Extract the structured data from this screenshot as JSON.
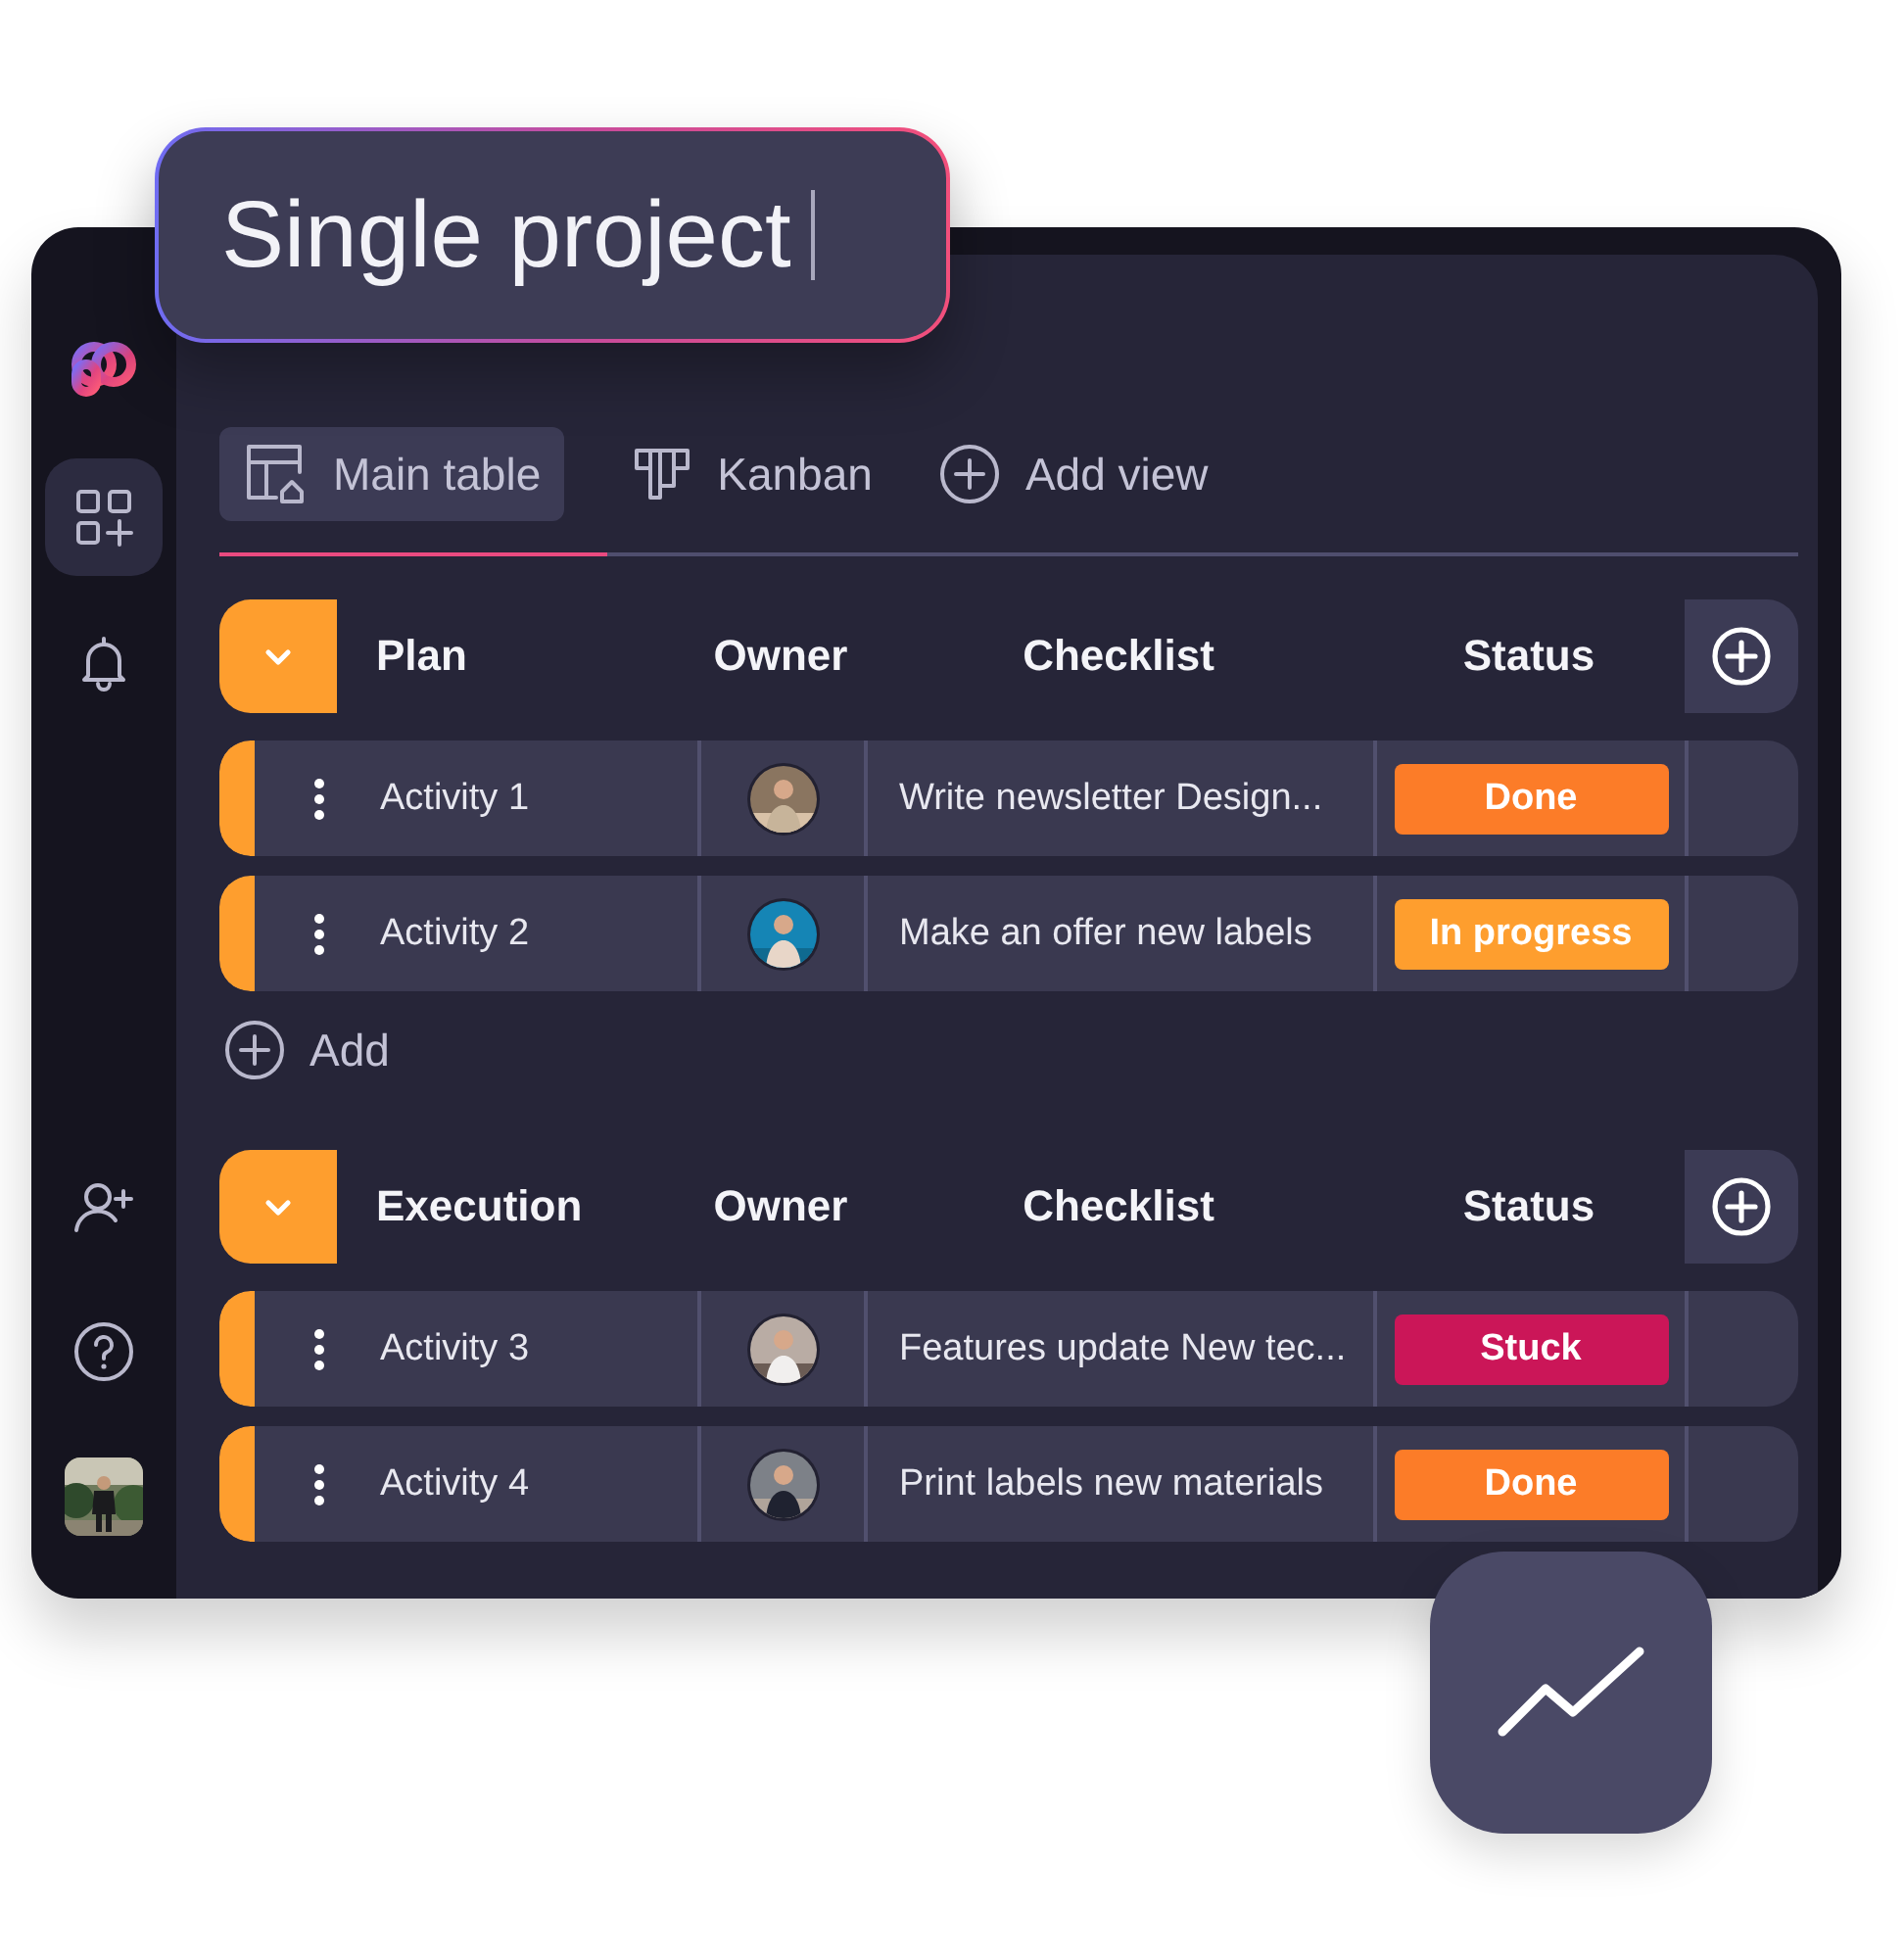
{
  "title_field": {
    "value": "Single project"
  },
  "sidebar": {
    "top_items": [
      {
        "kind": "apps",
        "selected": true
      },
      {
        "kind": "bell",
        "selected": false
      }
    ],
    "bottom_items": [
      {
        "kind": "invite",
        "selected": false
      },
      {
        "kind": "help",
        "selected": false
      },
      {
        "kind": "avatar",
        "selected": false
      }
    ]
  },
  "tabs": [
    {
      "label": "Main table",
      "kind": "table",
      "selected": true
    },
    {
      "label": "Kanban",
      "kind": "kanban",
      "selected": false
    }
  ],
  "add_view_button": {
    "label": "Add view"
  },
  "groups": [
    {
      "name": "Plan",
      "expanded": true,
      "columns": [
        "Owner",
        "Checklist",
        "Status"
      ],
      "rows": [
        {
          "name": "Activity 1",
          "checklist": "Write newsletter Design...",
          "status": "Done",
          "color": "#fc7c28"
        },
        {
          "name": "Activity 2",
          "checklist": "Make an offer new labels",
          "status": "In progress",
          "color": "#fe9e2e"
        }
      ],
      "add_label": "Add"
    },
    {
      "name": "Execution",
      "expanded": true,
      "columns": [
        "Owner",
        "Checklist",
        "Status"
      ],
      "rows": [
        {
          "name": "Activity 3",
          "checklist": "Features update New tec...",
          "status": "Stuck",
          "color": "#cb1658"
        },
        {
          "name": "Activity 4",
          "checklist": "Print labels new materials",
          "status": "Done",
          "color": "#fc7c28"
        }
      ]
    }
  ]
}
